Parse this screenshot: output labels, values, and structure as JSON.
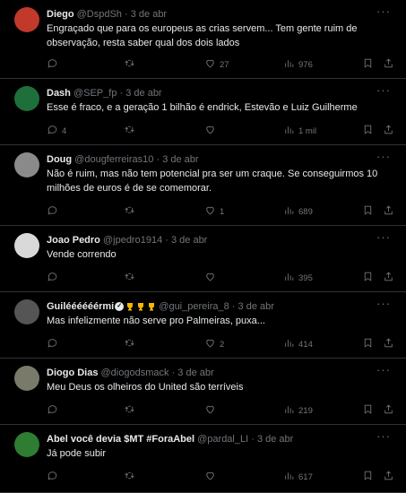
{
  "tweets": [
    {
      "name": "Diego",
      "handle": "@DspdSh",
      "dot": "·",
      "date": "3 de abr",
      "text": "Engraçado que para os europeus as crias servem... Tem gente ruim de observação, resta saber qual dos dois lados",
      "replies": "",
      "retweets": "",
      "likes": "27",
      "views": "976",
      "avatar_color": "#c0392b"
    },
    {
      "name": "Dash",
      "handle": "@SEP_fp",
      "dot": "·",
      "date": "3 de abr",
      "text": "Esse é fraco, e a geração 1 bilhão é endrick, Estevão e Luiz Guilherme",
      "replies": "4",
      "retweets": "",
      "likes": "",
      "views": "1 mil",
      "avatar_color": "#1e6f3a"
    },
    {
      "name": "Doug",
      "handle": "@dougferreiras10",
      "dot": "·",
      "date": "3 de abr",
      "text": "Não é ruim, mas não tem potencial pra ser um craque. Se conseguirmos 10 milhões de euros é de se comemorar.",
      "replies": "",
      "retweets": "",
      "likes": "1",
      "views": "689",
      "avatar_color": "#8a8a8a"
    },
    {
      "name": "Joao Pedro",
      "handle": "@jpedro1914",
      "dot": "·",
      "date": "3 de abr",
      "text": "Vende correndo",
      "replies": "",
      "retweets": "",
      "likes": "",
      "views": "395",
      "avatar_color": "#d9d9d9"
    },
    {
      "name": "Guiléééééérmi",
      "handle": "@gui_pereira_8",
      "dot": "·",
      "date": "3 de abr",
      "text": "Mas infelizmente não serve pro Palmeiras, puxa...",
      "replies": "",
      "retweets": "",
      "likes": "2",
      "views": "414",
      "avatar_color": "#555555"
    },
    {
      "name": "Diogo Dias",
      "handle": "@diogodsmack",
      "dot": "·",
      "date": "3 de abr",
      "text": "Meu Deus os olheiros do United são terríveis",
      "replies": "",
      "retweets": "",
      "likes": "",
      "views": "219",
      "avatar_color": "#7a7a6a"
    },
    {
      "name": "Abel você devia $MT #ForaAbel",
      "handle": "@pardal_LI",
      "dot": "·",
      "date": "3 de abr",
      "text": "Já pode subir",
      "replies": "",
      "retweets": "",
      "likes": "",
      "views": "617",
      "avatar_color": "#2e7d32"
    }
  ],
  "icons": {
    "reply": "reply-icon",
    "retweet": "retweet-icon",
    "like": "like-icon",
    "views": "views-icon",
    "bookmark": "bookmark-icon",
    "share": "share-icon",
    "more": "more-icon"
  }
}
